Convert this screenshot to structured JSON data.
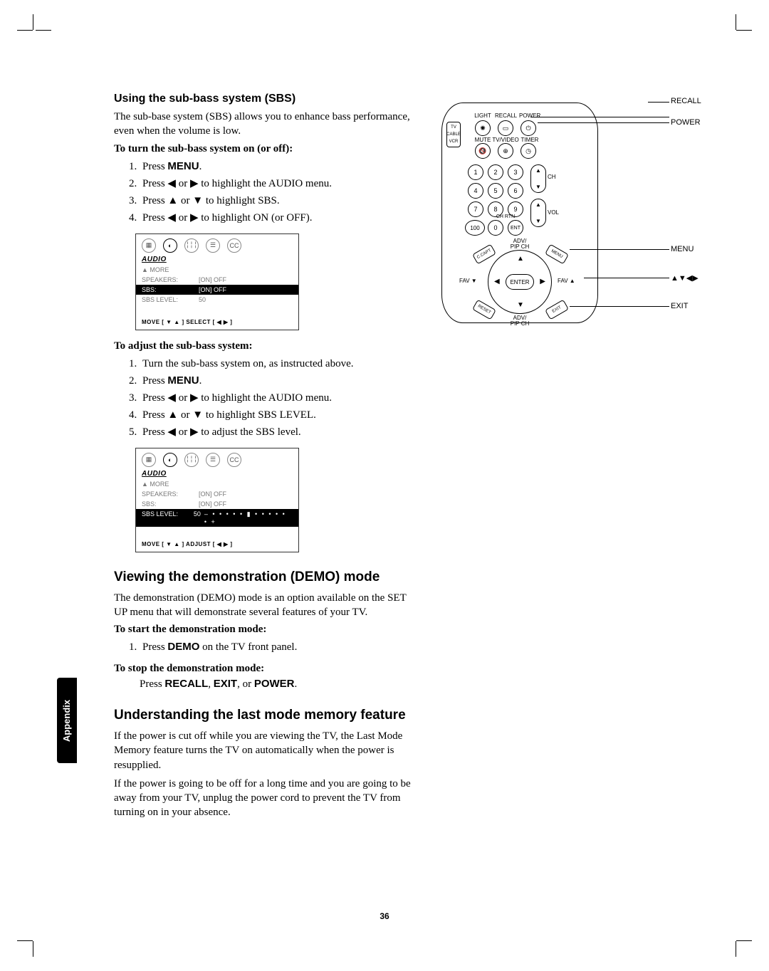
{
  "page_number": "36",
  "sidetab": "Appendix",
  "section1": {
    "heading": "Using the sub-bass system (SBS)",
    "intro": "The sub-base system (SBS) allows you to enhance bass performance, even when the volume is low.",
    "sub1": "To turn the sub-bass system on (or off):",
    "steps1": {
      "s1a": "Press ",
      "s1b": "MENU",
      "s1c": ".",
      "s2": "Press ◀ or ▶ to highlight the AUDIO menu.",
      "s3": "Press ▲ or ▼ to highlight SBS.",
      "s4": "Press ◀ or ▶ to highlight ON (or OFF)."
    },
    "osd1": {
      "title": "AUDIO",
      "r_more": "▲ MORE",
      "r_spk_l": "SPEAKERS:",
      "r_spk_v": "[ON] OFF",
      "r_sbs_l": "SBS:",
      "r_sbs_v": "[ON] OFF",
      "r_lvl_l": "SBS LEVEL:",
      "r_lvl_v": "50",
      "foot": "MOVE [ ▼ ▲ ]    SELECT [ ◀  ▶ ]"
    },
    "sub2": "To adjust the sub-bass system:",
    "steps2": {
      "s1": "Turn the sub-bass system on, as instructed above.",
      "s2a": "Press ",
      "s2b": "MENU",
      "s2c": ".",
      "s3": "Press ◀ or ▶ to highlight the AUDIO menu.",
      "s4": "Press ▲ or ▼ to highlight SBS LEVEL.",
      "s5": "Press ◀ or ▶ to adjust the SBS level."
    },
    "osd2": {
      "title": "AUDIO",
      "r_more": "▲ MORE",
      "r_spk_l": "SPEAKERS:",
      "r_spk_v": "[ON] OFF",
      "r_sbs_l": "SBS:",
      "r_sbs_v": "[ON] OFF",
      "r_lvl_l": "SBS LEVEL:",
      "r_lvl_v": "50",
      "slider": "– • • • • • ▮ • • • • • • +",
      "foot": "MOVE [ ▼ ▲ ]    ADJUST [ ◀  ▶ ]"
    }
  },
  "section2": {
    "heading": "Viewing the demonstration (DEMO) mode",
    "intro": "The demonstration (DEMO) mode is an option available on the SET UP menu that will demonstrate several features of your TV.",
    "sub1": "To start the demonstration mode:",
    "step1a": "Press ",
    "step1b": "DEMO",
    "step1c": " on the TV front panel.",
    "sub2": "To stop the demonstration mode:",
    "stop_a": "Press  ",
    "stop_b": "RECALL",
    "stop_c": ", ",
    "stop_d": "EXIT",
    "stop_e": ", or ",
    "stop_f": "POWER",
    "stop_g": "."
  },
  "section3": {
    "heading": "Understanding the last mode memory feature",
    "p1": "If the power is cut off while you are viewing the TV, the Last Mode Memory feature turns the TV on automatically when the power is resupplied.",
    "p2": "If the power is going to be off for a long time and you are going to be away from your TV, unplug the power cord to prevent the TV from turning on in your absence."
  },
  "remote": {
    "callout_recall": "RECALL",
    "callout_power": "POWER",
    "callout_menu": "MENU",
    "callout_arrows": "▲▼◀▶",
    "callout_exit": "EXIT",
    "lbl_light": "LIGHT",
    "lbl_recall": "RECALL",
    "lbl_power": "POWER",
    "lbl_mute": "MUTE",
    "lbl_tvvideo": "TV/VIDEO",
    "lbl_timer": "TIMER",
    "sw_tv": "TV",
    "sw_cable": "CABLE",
    "sw_vcr": "VCR",
    "n1": "1",
    "n2": "2",
    "n3": "3",
    "n4": "4",
    "n5": "5",
    "n6": "6",
    "n7": "7",
    "n8": "8",
    "n9": "9",
    "n0": "0",
    "n100": "100",
    "ent": "ENT",
    "ch": "CH",
    "vol": "VOL",
    "chrtn": "CH RTN",
    "adv": "ADV/",
    "pipch": "PIP CH",
    "ccapt": "C.CAPT",
    "menu": "MENU",
    "reset": "RESET",
    "exit": "EXIT",
    "favd": "FAV ▼",
    "favu": "FAV ▲",
    "enter": "ENTER"
  },
  "osd_icons": {
    "cc": "CC"
  }
}
